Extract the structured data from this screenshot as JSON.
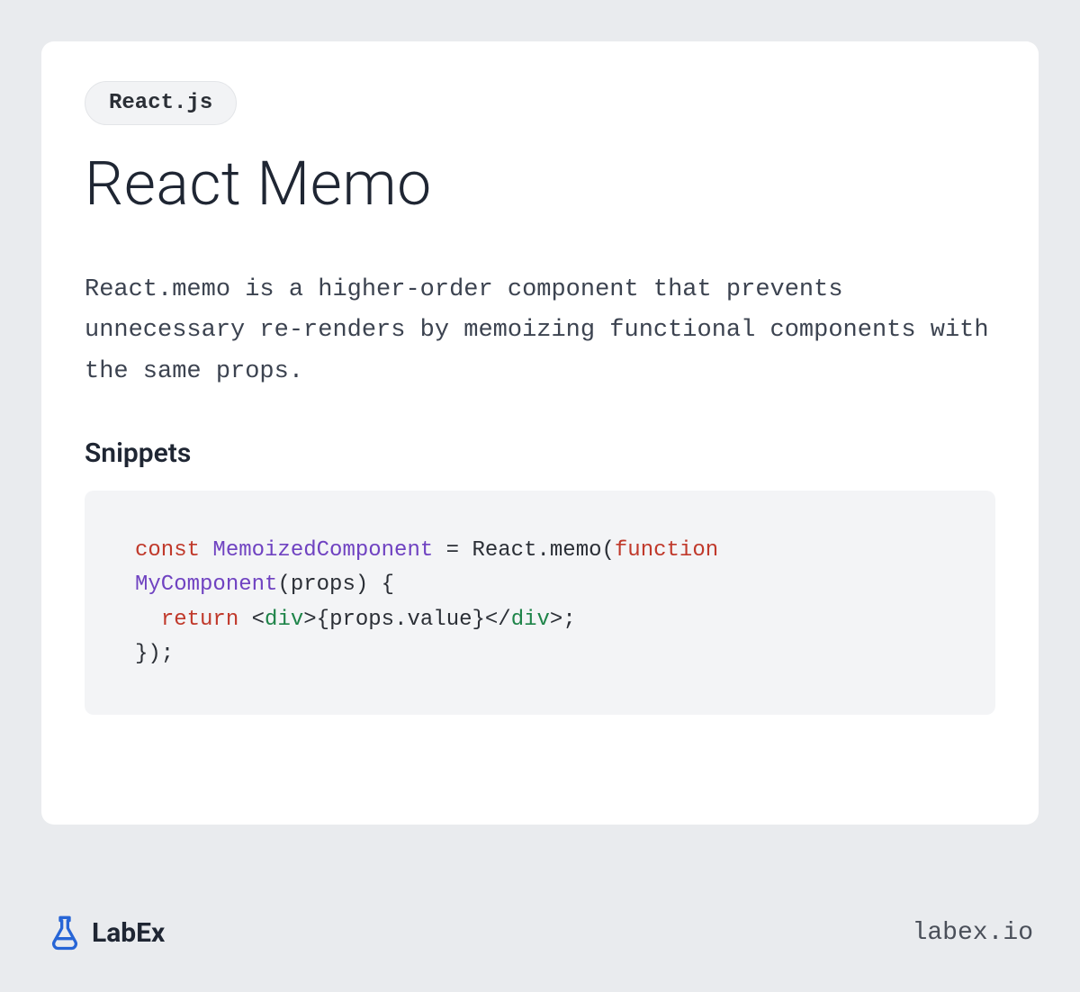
{
  "tag": "React.js",
  "title": "React Memo",
  "description": "React.memo is a higher-order component that prevents unnecessary re-renders by memoizing functional components with the same props.",
  "snippets_heading": "Snippets",
  "code_tokens": [
    {
      "t": "const ",
      "c": "tok-keyword"
    },
    {
      "t": "MemoizedComponent",
      "c": "tok-class"
    },
    {
      "t": " = React.memo(",
      "c": "tok-default"
    },
    {
      "t": "function",
      "c": "tok-keyword"
    },
    {
      "t": " ",
      "c": "tok-default"
    },
    {
      "t": "MyComponent",
      "c": "tok-func"
    },
    {
      "t": "(props) {\n  ",
      "c": "tok-default"
    },
    {
      "t": "return",
      "c": "tok-keyword"
    },
    {
      "t": " <",
      "c": "tok-default"
    },
    {
      "t": "div",
      "c": "tok-tag"
    },
    {
      "t": ">{props.value}</",
      "c": "tok-default"
    },
    {
      "t": "div",
      "c": "tok-tag"
    },
    {
      "t": ">;\n});",
      "c": "tok-default"
    }
  ],
  "brand_name": "LabEx",
  "site_url": "labex.io"
}
